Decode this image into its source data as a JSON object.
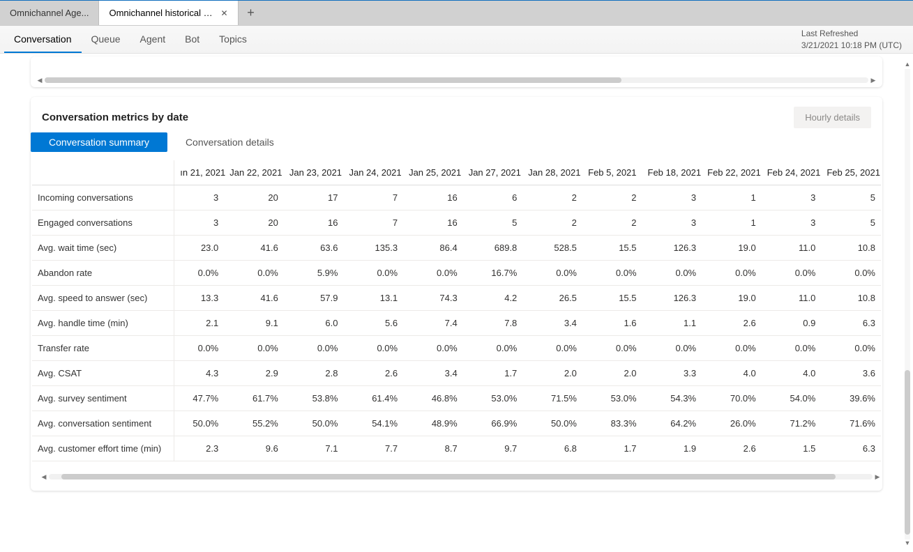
{
  "tabs": {
    "inactive": "Omnichannel Age...",
    "active": "Omnichannel historical an...",
    "closeGlyph": "✕",
    "addGlyph": "+"
  },
  "nav": {
    "items": [
      "Conversation",
      "Queue",
      "Agent",
      "Bot",
      "Topics"
    ],
    "activeIndex": 0
  },
  "refresh": {
    "label": "Last Refreshed",
    "value": "3/21/2021 10:18 PM (UTC)"
  },
  "card": {
    "title": "Conversation metrics by date",
    "hourlyBtn": "Hourly details",
    "pills": [
      "Conversation summary",
      "Conversation details"
    ],
    "activePill": 0
  },
  "columns": [
    "ın 21, 2021",
    "Jan 22, 2021",
    "Jan 23, 2021",
    "Jan 24, 2021",
    "Jan 25, 2021",
    "Jan 27, 2021",
    "Jan 28, 2021",
    "Feb 5, 2021",
    "Feb 18, 2021",
    "Feb 22, 2021",
    "Feb 24, 2021",
    "Feb 25, 2021"
  ],
  "metrics": [
    {
      "label": "Incoming conversations",
      "values": [
        "3",
        "20",
        "17",
        "7",
        "16",
        "6",
        "2",
        "2",
        "3",
        "1",
        "3",
        "5"
      ]
    },
    {
      "label": "Engaged conversations",
      "values": [
        "3",
        "20",
        "16",
        "7",
        "16",
        "5",
        "2",
        "2",
        "3",
        "1",
        "3",
        "5"
      ]
    },
    {
      "label": "Avg. wait time (sec)",
      "values": [
        "23.0",
        "41.6",
        "63.6",
        "135.3",
        "86.4",
        "689.8",
        "528.5",
        "15.5",
        "126.3",
        "19.0",
        "11.0",
        "10.8"
      ]
    },
    {
      "label": "Abandon rate",
      "values": [
        "0.0%",
        "0.0%",
        "5.9%",
        "0.0%",
        "0.0%",
        "16.7%",
        "0.0%",
        "0.0%",
        "0.0%",
        "0.0%",
        "0.0%",
        "0.0%"
      ]
    },
    {
      "label": "Avg. speed to answer (sec)",
      "values": [
        "13.3",
        "41.6",
        "57.9",
        "13.1",
        "74.3",
        "4.2",
        "26.5",
        "15.5",
        "126.3",
        "19.0",
        "11.0",
        "10.8"
      ]
    },
    {
      "label": "Avg. handle time (min)",
      "values": [
        "2.1",
        "9.1",
        "6.0",
        "5.6",
        "7.4",
        "7.8",
        "3.4",
        "1.6",
        "1.1",
        "2.6",
        "0.9",
        "6.3"
      ]
    },
    {
      "label": "Transfer rate",
      "values": [
        "0.0%",
        "0.0%",
        "0.0%",
        "0.0%",
        "0.0%",
        "0.0%",
        "0.0%",
        "0.0%",
        "0.0%",
        "0.0%",
        "0.0%",
        "0.0%"
      ]
    },
    {
      "label": "Avg. CSAT",
      "values": [
        "4.3",
        "2.9",
        "2.8",
        "2.6",
        "3.4",
        "1.7",
        "2.0",
        "2.0",
        "3.3",
        "4.0",
        "4.0",
        "3.6"
      ]
    },
    {
      "label": "Avg. survey sentiment",
      "values": [
        "47.7%",
        "61.7%",
        "53.8%",
        "61.4%",
        "46.8%",
        "53.0%",
        "71.5%",
        "53.0%",
        "54.3%",
        "70.0%",
        "54.0%",
        "39.6%"
      ]
    },
    {
      "label": "Avg. conversation sentiment",
      "values": [
        "50.0%",
        "55.2%",
        "50.0%",
        "54.1%",
        "48.9%",
        "66.9%",
        "50.0%",
        "83.3%",
        "64.2%",
        "26.0%",
        "71.2%",
        "71.6%"
      ]
    },
    {
      "label": "Avg. customer effort time (min)",
      "values": [
        "2.3",
        "9.6",
        "7.1",
        "7.7",
        "8.7",
        "9.7",
        "6.8",
        "1.7",
        "1.9",
        "2.6",
        "1.5",
        "6.3"
      ]
    }
  ]
}
